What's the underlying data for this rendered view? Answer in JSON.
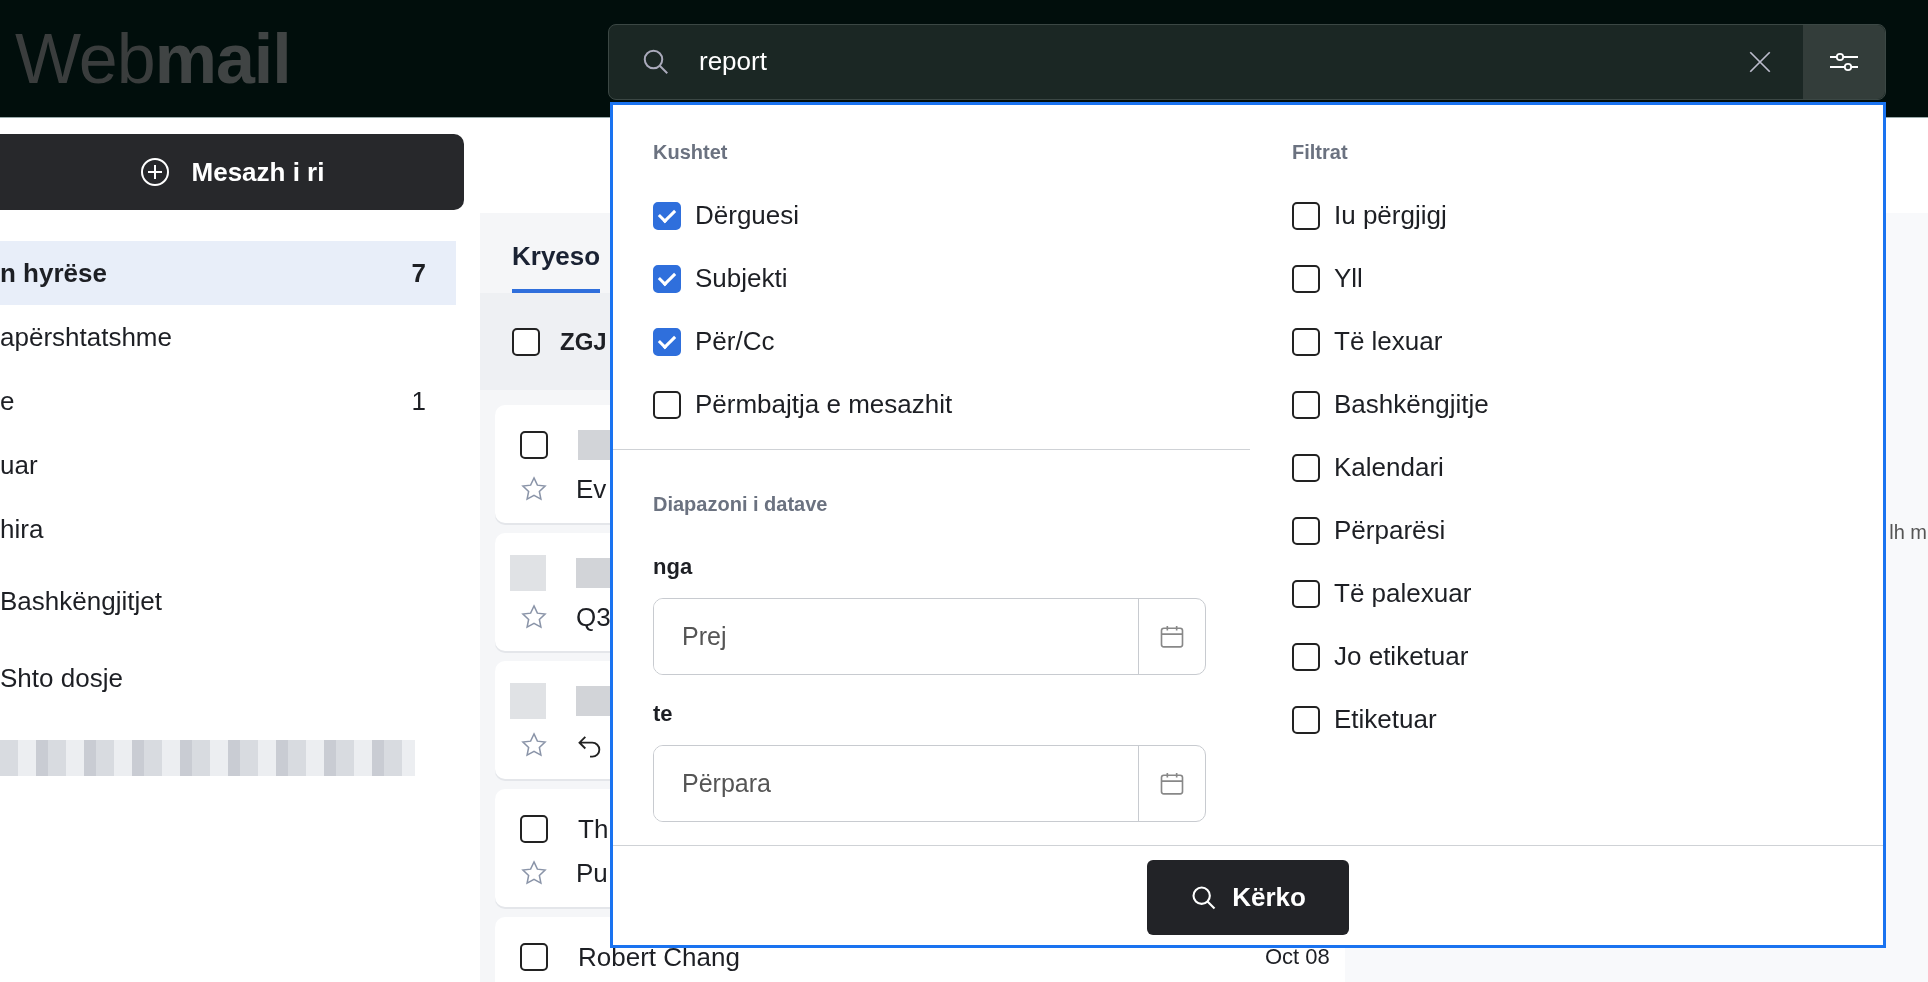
{
  "header": {
    "logo_light": "Web",
    "logo_bold": "mail"
  },
  "search": {
    "value": "report"
  },
  "sidebar": {
    "new_message": "Mesazh i ri",
    "folders": [
      {
        "label": "n hyrëse",
        "count": "7",
        "selected": true
      },
      {
        "label": "apërshtatshme",
        "selected": false
      },
      {
        "label": "e",
        "count": "1",
        "selected": false
      },
      {
        "label": "uar",
        "selected": false
      },
      {
        "label": "hira",
        "selected": false
      },
      {
        "label": "Bashkëngjitjet",
        "selected": false
      },
      {
        "label": "Shto dosje",
        "selected": false
      }
    ]
  },
  "list": {
    "tabs": [
      {
        "label": "Kryeso",
        "selected": true
      }
    ],
    "select_all": {
      "label": "ZGJ",
      "checked": false
    },
    "messages": [
      {
        "kind": "checkbox",
        "checked": false,
        "starred": false,
        "subject": "Ev"
      },
      {
        "kind": "avatar",
        "starred": false,
        "subject": "Q3"
      },
      {
        "kind": "avatar",
        "starred": false,
        "replied": true
      },
      {
        "kind": "checkbox",
        "checked": false,
        "starred": false,
        "sender": "Th",
        "subject": "Pu"
      },
      {
        "kind": "checkbox",
        "checked": false,
        "sender": "Robert Chang",
        "date": "Oct 08"
      }
    ]
  },
  "reading_pane": {
    "hint": "lh m"
  },
  "search_options": {
    "conditions_title": "Kushtet",
    "conditions": [
      {
        "label": "Dërguesi",
        "checked": true
      },
      {
        "label": "Subjekti",
        "checked": true
      },
      {
        "label": "Për/Cc",
        "checked": true
      },
      {
        "label": "Përmbajtja e mesazhit",
        "checked": false
      }
    ],
    "date_range": {
      "title": "Diapazoni i datave",
      "from": {
        "label": "nga",
        "placeholder": "Prej"
      },
      "to": {
        "label": "te",
        "placeholder": "Përpara"
      }
    },
    "filters_title": "Filtrat",
    "filters": [
      {
        "label": "Iu përgjigj",
        "checked": false
      },
      {
        "label": "Yll",
        "checked": false
      },
      {
        "label": "Të lexuar",
        "checked": false
      },
      {
        "label": "Bashkëngjitje",
        "checked": false
      },
      {
        "label": "Kalendari",
        "checked": false
      },
      {
        "label": "Përparësi",
        "checked": false
      },
      {
        "label": "Të palexuar",
        "checked": false
      },
      {
        "label": "Jo etiketuar",
        "checked": false
      },
      {
        "label": "Etiketuar",
        "checked": false
      }
    ],
    "submit": "Kërko"
  }
}
